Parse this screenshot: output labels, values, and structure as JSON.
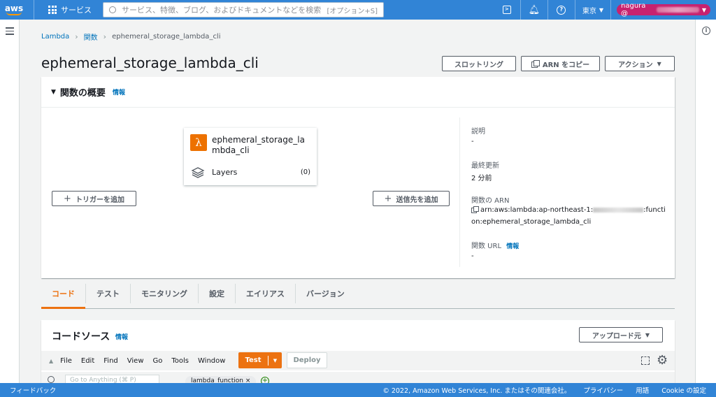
{
  "topnav": {
    "logo_text": "aws",
    "services_label": "サービス",
    "search_placeholder": "サービス、特徴、ブログ、およびドキュメントなどを検索",
    "search_shortcut": "[オプション+S]",
    "region": "東京",
    "account": "nagura @"
  },
  "breadcrumb": {
    "items": [
      "Lambda",
      "関数",
      "ephemeral_storage_lambda_cli"
    ]
  },
  "page": {
    "title": "ephemeral_storage_lambda_cli",
    "throttle_label": "スロットリング",
    "copy_arn_label": "ARN をコピー",
    "actions_label": "アクション"
  },
  "overview": {
    "title": "関数の概要",
    "info": "情報",
    "function_name": "ephemeral_storage_lambda_cli",
    "layers_label": "Layers",
    "layers_count": "(0)",
    "add_trigger": "トリガーを追加",
    "add_destination": "送信先を追加",
    "description_label": "説明",
    "description_value": "-",
    "last_modified_label": "最終更新",
    "last_modified_value": "2 分前",
    "arn_label": "関数の ARN",
    "arn_prefix": "arn:aws:lambda:ap-northeast-1:",
    "arn_suffix_1": ":functi",
    "arn_suffix_2": "on:ephemeral_storage_lambda_cli",
    "url_label": "関数 URL",
    "url_info": "情報",
    "url_value": "-"
  },
  "tabs": [
    {
      "label": "コード",
      "active": true
    },
    {
      "label": "テスト",
      "active": false
    },
    {
      "label": "モニタリング",
      "active": false
    },
    {
      "label": "設定",
      "active": false
    },
    {
      "label": "エイリアス",
      "active": false
    },
    {
      "label": "バージョン",
      "active": false
    }
  ],
  "codesource": {
    "title": "コードソース",
    "info": "情報",
    "upload_label": "アップロード元",
    "menus": [
      "File",
      "Edit",
      "Find",
      "View",
      "Go",
      "Tools",
      "Window"
    ],
    "test_label": "Test",
    "deploy_label": "Deploy",
    "goto_placeholder": "Go to Anything (⌘ P)",
    "file_tab": "lambda_function ×"
  },
  "footer": {
    "feedback": "フィードバック",
    "copyright": "© 2022, Amazon Web Services, Inc. またはその関連会社。",
    "privacy": "プライバシー",
    "terms": "用語",
    "cookie": "Cookie の設定"
  },
  "colors": {
    "nav_bg": "#3184d6",
    "accent_orange": "#ec7211",
    "link": "#0073bb",
    "account_badge": "#c7226f"
  }
}
